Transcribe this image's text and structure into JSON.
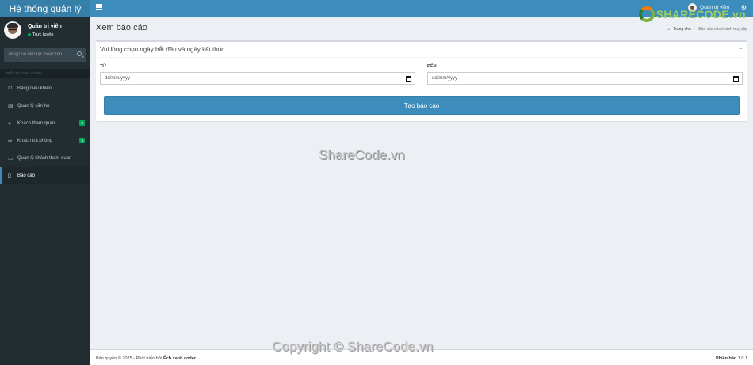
{
  "header": {
    "app_title": "Hệ thống quản lý",
    "user_name": "Quản trị viên"
  },
  "sidebar": {
    "user_name": "Quản trị viên",
    "status": "Trực tuyến",
    "search_placeholder": "Nhập số liên lạc hoặc tên",
    "section_header": "ĐIỀU HƯỚNG CHÍNH",
    "items": [
      {
        "label": "Bảng điều khiển",
        "icon": "dashboard-icon",
        "glyph": "⏲"
      },
      {
        "label": "Quản lý căn hộ",
        "icon": "building-icon",
        "glyph": "▤"
      },
      {
        "label": "Khách tham quan",
        "icon": "plus-icon",
        "glyph": "+",
        "badge": "0"
      },
      {
        "label": "Khách trả phòng",
        "icon": "sign-out-icon",
        "glyph": "⇨",
        "badge": "5"
      },
      {
        "label": "Quản lý khách tham quan",
        "icon": "id-card-icon",
        "glyph": "▭"
      },
      {
        "label": "Báo cáo",
        "icon": "file-icon",
        "glyph": "▯"
      }
    ]
  },
  "page": {
    "title": "Xem báo cáo",
    "breadcrumb_home": "Trang chủ",
    "breadcrumb_current": "Báo cáo của khách truy cập",
    "brand_logo_text": "SHARECODE.vn"
  },
  "report_form": {
    "box_title": "Vui lòng chọn ngày bắt đầu và ngày kết thúc",
    "collapse_label": "−",
    "from_label": "TỪ",
    "from_placeholder": "dd/mm/yyyy",
    "to_label": "ĐẾN",
    "to_placeholder": "dd/mm/yyyy",
    "submit_label": "Tạo báo cáo"
  },
  "watermarks": {
    "center": "ShareCode.vn",
    "bottom": "Copyright © ShareCode.vn"
  },
  "footer": {
    "copyright_prefix": "Bản quyền © 2025 - Phát triển bởi",
    "author": "Ếch xanh coder",
    "version_label": "Phiên bản",
    "version": "1.0.1"
  },
  "colors": {
    "header_dark": "#367fa9",
    "header": "#3c8dbc",
    "sidebar": "#222d32",
    "content_bg": "#ecf0f5",
    "badge": "#00a65a"
  }
}
